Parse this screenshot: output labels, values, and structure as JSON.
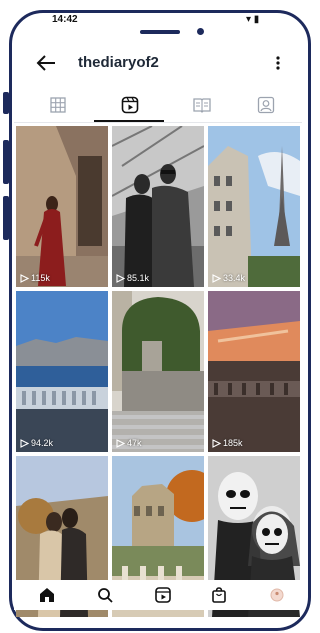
{
  "status": {
    "time": "14:42",
    "right": "▾ ▮"
  },
  "header": {
    "title": "thediaryof2"
  },
  "tabs": [
    {
      "name": "grid",
      "icon": "grid-icon",
      "active": false
    },
    {
      "name": "reels",
      "icon": "reels-icon",
      "active": true
    },
    {
      "name": "guides",
      "icon": "book-icon",
      "active": false
    },
    {
      "name": "tagged",
      "icon": "tagged-user-icon",
      "active": false
    }
  ],
  "reels": [
    {
      "views": "115k",
      "scene": "woman-in-red-dress-archway"
    },
    {
      "views": "85.1k",
      "scene": "couple-black-and-white"
    },
    {
      "views": "33.4k",
      "scene": "eiffel-tower-buildings"
    },
    {
      "views": "94.2k",
      "scene": "seine-river-bridge"
    },
    {
      "views": "47k",
      "scene": "street-with-crosswalk-trees"
    },
    {
      "views": "185k",
      "scene": "sunset-over-bridge"
    },
    {
      "views": "",
      "scene": "couple-kissing-outdoors"
    },
    {
      "views": "",
      "scene": "palace-garden-autumn"
    },
    {
      "views": "",
      "scene": "couple-skull-makeup"
    }
  ],
  "bottom_nav": [
    {
      "name": "home",
      "icon": "home-icon",
      "active": true
    },
    {
      "name": "search",
      "icon": "search-icon",
      "active": false
    },
    {
      "name": "reels",
      "icon": "reels-icon",
      "active": false
    },
    {
      "name": "shop",
      "icon": "shopping-bag-icon",
      "active": false
    },
    {
      "name": "profile",
      "icon": "avatar-icon",
      "active": false
    }
  ]
}
